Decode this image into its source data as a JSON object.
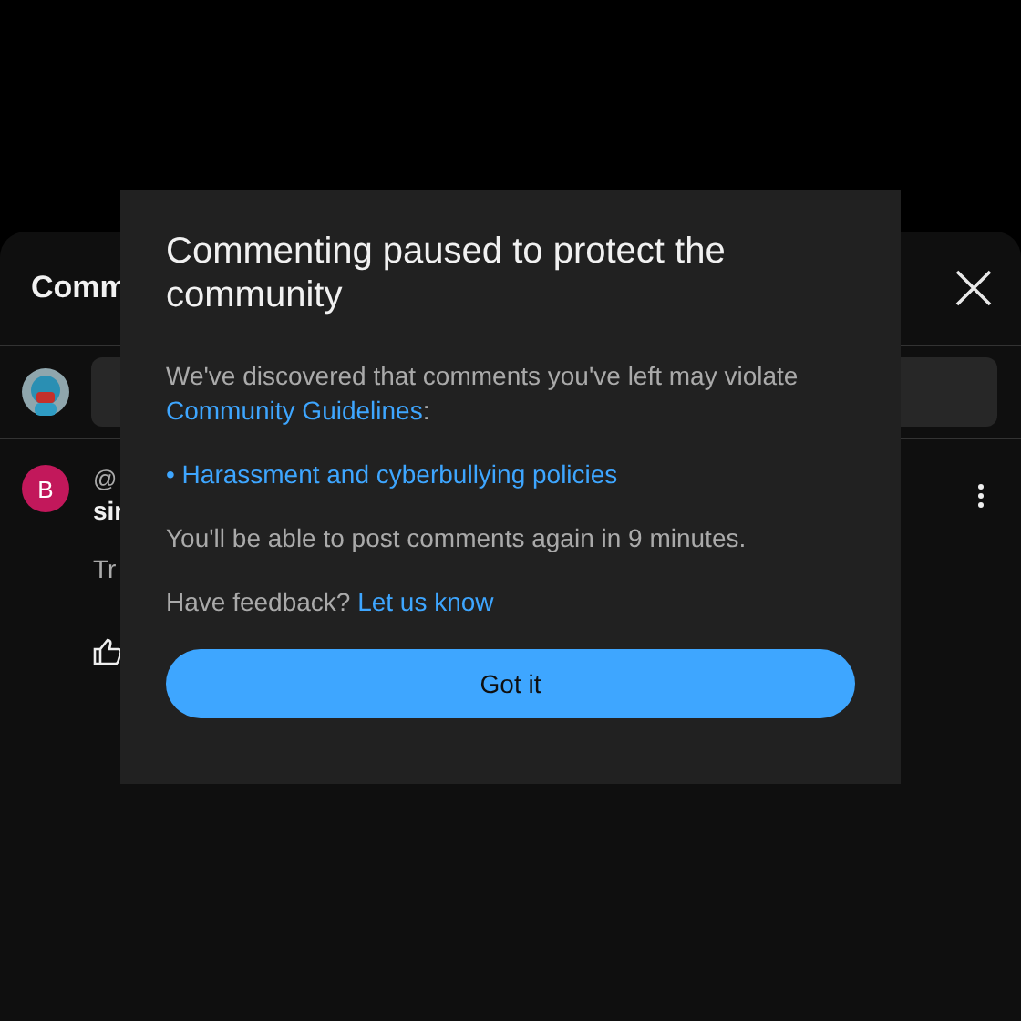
{
  "sheet": {
    "title": "Comm",
    "comments": [
      {
        "avatar_letter": "B",
        "color": "#c2185b",
        "handle": "@",
        "title": "sir",
        "text": "Tr"
      }
    ]
  },
  "dialog": {
    "title": "Commenting paused to protect the community",
    "intro": "We've discovered that comments you've left may violate",
    "guidelines_link": "Community Guidelines",
    "intro_end": ":",
    "policies": [
      "• Harassment and cyberbullying policies"
    ],
    "notice": "You'll be able to post comments again in 9 minutes.",
    "feedback": "Have feedback?",
    "feedback_link": "Let us know",
    "button": "Got it"
  }
}
